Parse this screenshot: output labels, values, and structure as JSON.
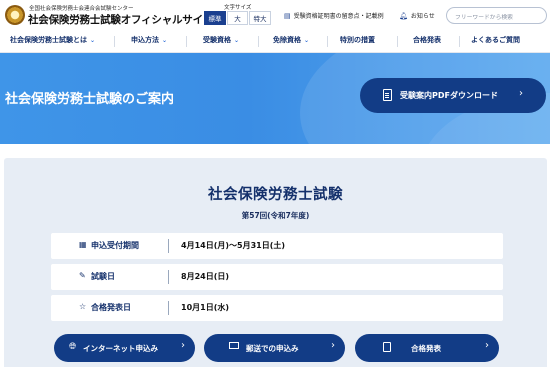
{
  "header": {
    "org_small": "全国社会保険労務士会連合会試験センター",
    "site_title": "社会保険労務士試験オフィシャルサイト",
    "font_size_label": "文字サイズ",
    "font_size_options": [
      "標準",
      "大",
      "特大"
    ],
    "notice_link": "受験資格証明書の留意点・記載例",
    "news_link": "お知らせ",
    "search_placeholder": "フリーワードから検索"
  },
  "nav": {
    "items": [
      "社会保険労務士試験とは",
      "申込方法",
      "受験資格",
      "免除資格",
      "特別の措置",
      "合格発表",
      "よくあるご質問"
    ]
  },
  "hero": {
    "title": "社会保険労務士試験のご案内",
    "pdf_button": "受験案内PDFダウンロード"
  },
  "exam": {
    "title": "社会保険労務士試験",
    "subtitle": "第57回(令和7年度)",
    "rows": [
      {
        "icon": "calendar-icon",
        "label": "申込受付期間",
        "value": "4月14日(月)〜5月31日(土)"
      },
      {
        "icon": "pen-icon",
        "label": "試験日",
        "value": "8月24日(日)"
      },
      {
        "icon": "star-icon",
        "label": "合格発表日",
        "value": "10月1日(水)"
      }
    ]
  },
  "actions": [
    {
      "icon": "globe-icon",
      "label": "インターネット申込み"
    },
    {
      "icon": "mail-icon",
      "label": "郵送での申込み"
    },
    {
      "icon": "document-icon",
      "label": "合格発表"
    }
  ],
  "colors": {
    "primary_navy": "#123c86",
    "hero_blue": "#3f95e8",
    "panel_bg": "#e7edf5"
  }
}
